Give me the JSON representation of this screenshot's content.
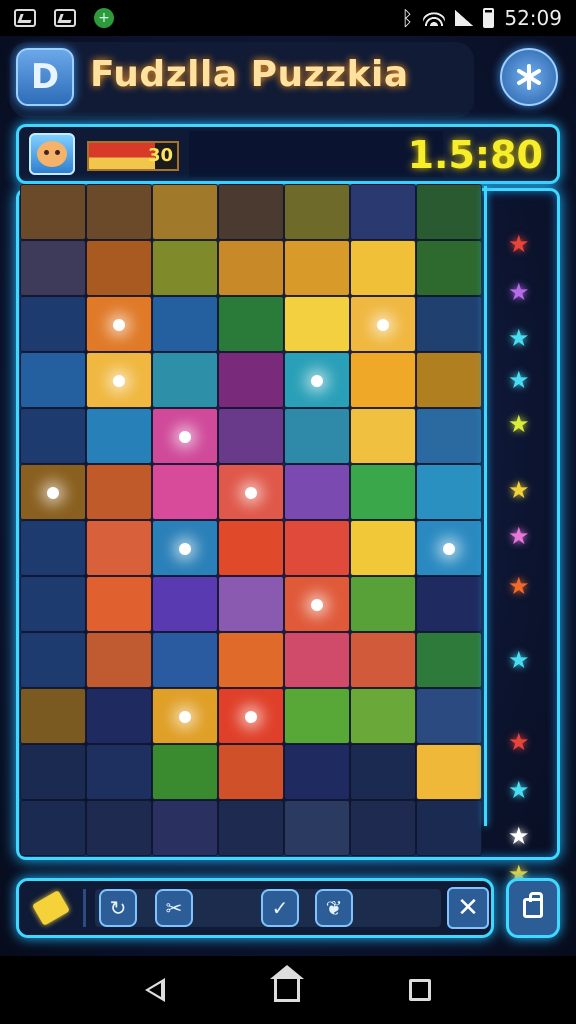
{
  "status_bar": {
    "time": "52:09",
    "left_icons": [
      "image-icon",
      "photo-icon",
      "add-circle-icon"
    ],
    "right_icons": [
      "bluetooth-icon",
      "wifi-icon",
      "signal-icon",
      "battery-icon"
    ]
  },
  "header": {
    "logo_letter": "D",
    "title": "Fudzlla Puzzkia",
    "settings_icon": "asterisk-settings-icon"
  },
  "hud": {
    "progress_text": "30",
    "progress_fraction": 0.75,
    "timer": "1.5:80"
  },
  "board": {
    "columns": 7,
    "rows": 12,
    "tile_colors": [
      [
        "#6b4a2a",
        "#6b4a2a",
        "#a07a2a",
        "#4a3a30",
        "#6e6a2a",
        "#2a3a70",
        "#2a5a30"
      ],
      [
        "#3d3a5a",
        "#a85a20",
        "#7f8a2a",
        "#c88a28",
        "#d89a28",
        "#f0c038",
        "#2e6a2e"
      ],
      [
        "#1e3b70",
        "#e07a28",
        "#2460a0",
        "#2a7a3a",
        "#f2d040",
        "#f0b840",
        "#204070"
      ],
      [
        "#2460a0",
        "#f0b840",
        "#2e90a8",
        "#7a2a7a",
        "#2aa0b8",
        "#f0a828",
        "#b08020"
      ],
      [
        "#1e3b70",
        "#2880b8",
        "#d04a9a",
        "#6a3a8a",
        "#2e8aa8",
        "#f0c040",
        "#2a6aa0"
      ],
      [
        "#8a6020",
        "#c05a2a",
        "#d84a9a",
        "#e0584a",
        "#7a4ab0",
        "#3aa84a",
        "#2a90c0"
      ],
      [
        "#1e3b70",
        "#d8603a",
        "#2a80b8",
        "#e04a2a",
        "#e04a3a",
        "#f0c838",
        "#2a8ac0"
      ],
      [
        "#1e3b70",
        "#e06030",
        "#5a3ab0",
        "#8a5ab0",
        "#e05a3a",
        "#58a038",
        "#1e2a60"
      ],
      [
        "#1e3b70",
        "#c05a30",
        "#2a5aa0",
        "#e06a2a",
        "#d04a6a",
        "#d05a3a",
        "#2e7a3a"
      ],
      [
        "#7a5a20",
        "#1e2a60",
        "#e0a028",
        "#e0402a",
        "#58a838",
        "#6aa83a",
        "#2a4a80"
      ],
      [
        "#1a2a50",
        "#1e3060",
        "#3a8a30",
        "#d0502a",
        "#1e2a60",
        "#1a2a50",
        "#f0b838"
      ],
      [
        "#1a2a50",
        "#1e2a50",
        "#2a3060",
        "#1e2a50",
        "#2a3a60",
        "#1e2a50",
        "#1a2a50"
      ]
    ],
    "lit_tiles": [
      [
        2,
        1
      ],
      [
        3,
        1
      ],
      [
        3,
        4
      ],
      [
        4,
        2
      ],
      [
        5,
        3
      ],
      [
        6,
        2
      ],
      [
        7,
        4
      ],
      [
        9,
        2
      ],
      [
        9,
        3
      ],
      [
        5,
        0
      ],
      [
        6,
        6
      ],
      [
        2,
        5
      ]
    ]
  },
  "side_stars": [
    {
      "color": "#e8443a"
    },
    {
      "color": "#b86ae8"
    },
    {
      "color": "#4adcf0"
    },
    {
      "color": "#4adcf0"
    },
    {
      "color": "#d8ee3a"
    },
    {
      "color": "#f2d23a"
    },
    {
      "color": "#e878d8"
    },
    {
      "color": "#f06a2a"
    },
    {
      "color": "#4adcf0"
    },
    {
      "color": "#e8443a"
    },
    {
      "color": "#4adcf0"
    },
    {
      "color": "#ffffff"
    },
    {
      "color": "#f2d23a"
    }
  ],
  "toolbar": {
    "buttons": [
      {
        "icon": "refresh-icon",
        "glyph": "↻"
      },
      {
        "icon": "scissors-icon",
        "glyph": "✂"
      },
      {
        "icon": "check-icon",
        "glyph": "✓"
      },
      {
        "icon": "leaf-icon",
        "glyph": "❦"
      }
    ],
    "close_glyph": "✕"
  },
  "nav": [
    "back-icon",
    "home-icon",
    "recent-apps-icon"
  ]
}
